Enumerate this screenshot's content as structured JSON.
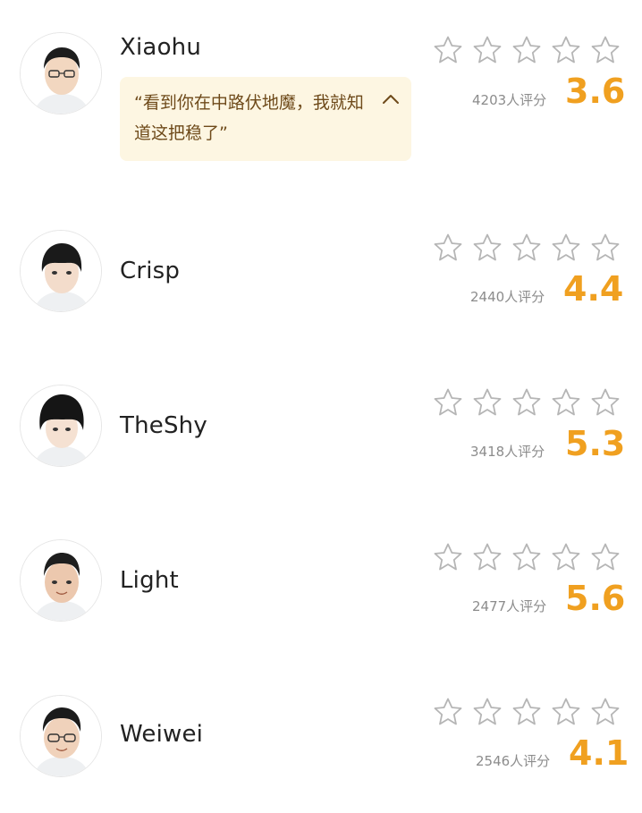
{
  "players": [
    {
      "name": "Xiaohu",
      "rating_count": "4203人评分",
      "score": "3.6",
      "stars_filled": 0,
      "quote": "“看到你在中路伏地魔，我就知道这把稳了”"
    },
    {
      "name": "Crisp",
      "rating_count": "2440人评分",
      "score": "4.4",
      "stars_filled": 0
    },
    {
      "name": "TheShy",
      "rating_count": "3418人评分",
      "score": "5.3",
      "stars_filled": 0
    },
    {
      "name": "Light",
      "rating_count": "2477人评分",
      "score": "5.6",
      "stars_filled": 0
    },
    {
      "name": "Weiwei",
      "rating_count": "2546人评分",
      "score": "4.1",
      "stars_filled": 0
    }
  ],
  "icons": {
    "star": "star-outline-icon",
    "collapse": "chevron-up-icon"
  },
  "colors": {
    "score": "#f0a020",
    "star_outline": "#b5b5b5",
    "quote_bg": "#fdf6e2",
    "quote_text": "#6e4a1a"
  }
}
